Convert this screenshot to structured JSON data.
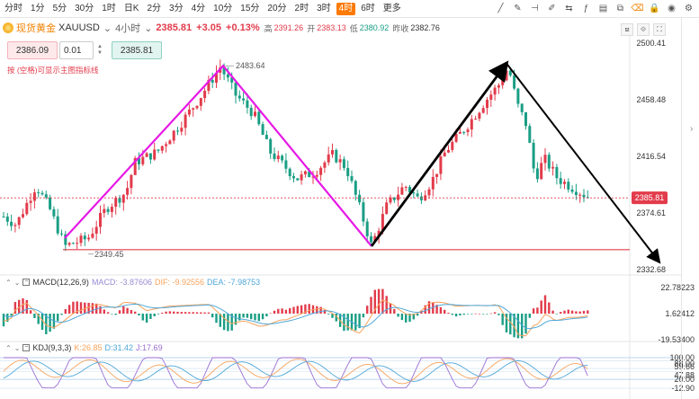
{
  "toolbar": {
    "timeframes": [
      "分时",
      "1分",
      "5分",
      "30分",
      "1时",
      "日K",
      "2分",
      "3分",
      "4分",
      "10分",
      "15分",
      "20分",
      "2时",
      "3时",
      "4时",
      "6时",
      "更多"
    ],
    "active_timeframe": "4时",
    "tools": [
      "trend-line-icon",
      "pencil-icon",
      "ruler-icon",
      "brush-icon",
      "measure-icon",
      "function-icon",
      "layout-icon",
      "snapshot-icon",
      "eraser-icon",
      "lock-icon",
      "eye-icon",
      "settings-icon"
    ]
  },
  "title": {
    "name": "现货黄金",
    "symbol": "XAUUSD",
    "timeframe_label": "4小时",
    "price": "2385.81",
    "change": "+3.05",
    "change_pct": "+0.13%",
    "high_label": "高",
    "high": "2391.26",
    "open_label": "开",
    "open": "2383.13",
    "low_label": "低",
    "low": "2380.92",
    "prev_close_label": "昨收",
    "prev_close": "2382.76"
  },
  "order": {
    "sell_price": "2386.09",
    "lot": "0.01",
    "buy_price": "2385.81"
  },
  "hint": "按 (空格)可显示主图指标线",
  "chart_data": [
    {
      "type": "candlestick",
      "y_axis_ticks": [
        "2500.41",
        "2458.48",
        "2416.54",
        "2374.61",
        "2332.68"
      ],
      "ylim": [
        2332.68,
        2500.41
      ],
      "current_price": "2385.81",
      "annotations": [
        "2483.64",
        "2349.45"
      ],
      "current_price_color": "#e23b4b"
    },
    {
      "type": "bar",
      "name": "MACD(12,26,9)",
      "macd_label": "MACD",
      "macd_value": "-3.87606",
      "dif_label": "DIF",
      "dif_value": "-9.92556",
      "dea_label": "DEA",
      "dea_value": "-7.98753",
      "y_axis_ticks": [
        "22.78223",
        "1.62412",
        "-19.53400"
      ]
    },
    {
      "type": "line",
      "name": "KDJ(9,3,3)",
      "k_label": "K",
      "k_value": "26.85",
      "d_label": "D",
      "d_value": "31.42",
      "j_label": "J",
      "j_value": "17.69",
      "y_axis_ticks": [
        "100.00",
        "88.00",
        "59.66",
        "47.88",
        "20.00",
        "-12.90"
      ]
    }
  ],
  "colors": {
    "up": "#e23b4b",
    "down": "#1a9e85",
    "accent": "#ff7a00",
    "wave_pink": "#e619e6",
    "wave_black": "#000000",
    "support": "#e23b4b"
  }
}
